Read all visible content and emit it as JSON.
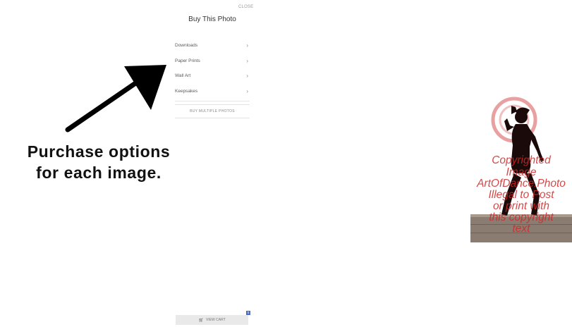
{
  "panel": {
    "close_label": "CLOSE",
    "title": "Buy This Photo",
    "menu": [
      {
        "label": "Downloads"
      },
      {
        "label": "Paper Prints"
      },
      {
        "label": "Wall Art"
      },
      {
        "label": "Keepsakes"
      }
    ],
    "buy_multiple_label": "BUY MULTIPLE PHOTOS"
  },
  "annotation": {
    "line1": "Purchase options",
    "line2": "for each image."
  },
  "photo": {
    "watermark": [
      "Copyrighted",
      "Image",
      "ArtOfDance.Photo",
      "Illegal to Post",
      "or print with",
      "this copyright",
      "text"
    ]
  },
  "cart": {
    "label": "VIEW CART",
    "count": "0"
  },
  "icons": {
    "chevron": "chevron-right-icon",
    "cart": "cart-icon",
    "arrow": "arrow-icon"
  },
  "colors": {
    "watermark": "#cd2828",
    "badge": "#4d6cc4"
  }
}
